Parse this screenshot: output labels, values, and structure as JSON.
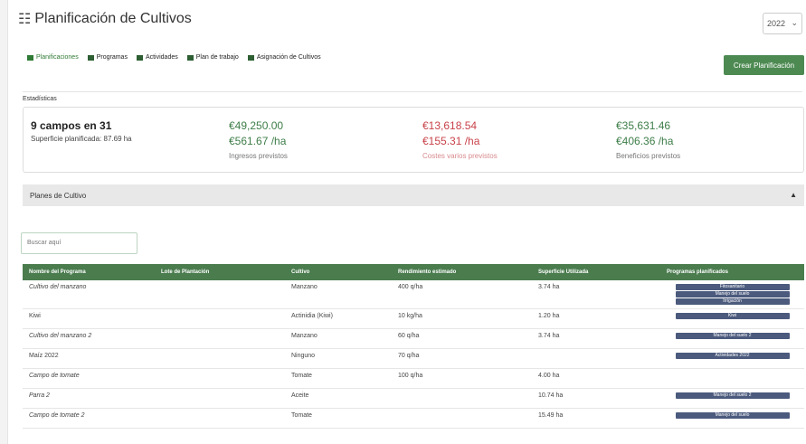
{
  "header": {
    "title": "Planificación de Cultivos",
    "year": "2022"
  },
  "tabs": [
    {
      "label": "Planificaciones",
      "active": true
    },
    {
      "label": "Programas"
    },
    {
      "label": "Actividades"
    },
    {
      "label": "Plan de trabajo"
    },
    {
      "label": "Asignación de Cultivos"
    }
  ],
  "create_button": "Crear Planificación",
  "stats": {
    "label": "Estadísticas",
    "campos": "9 campos en 31",
    "superficie": "Superficie planificada: 87.69 ha",
    "ingresos_total": "€49,250.00",
    "ingresos_ha": "€561.67 /ha",
    "ingresos_label": "Ingresos previstos",
    "costes_total": "€13,618.54",
    "costes_ha": "€155.31 /ha",
    "costes_label": "Costes varios previstos",
    "beneficios_total": "€35,631.46",
    "beneficios_ha": "€406.36 /ha",
    "beneficios_label": "Beneficios previstos"
  },
  "plans": {
    "title": "Planes de Cultivo",
    "search_placeholder": "Buscar aquí"
  },
  "table": {
    "headers": [
      "Nombre del Programa",
      "Lote de Plantación",
      "Cultivo",
      "Rendimiento estimado",
      "Superficie Utilizada",
      "Programas planificados"
    ],
    "rows": [
      {
        "name": "Cultivo del manzano",
        "lote": "",
        "cultivo": "Manzano",
        "rend": "400 q/ha",
        "sup": "3.74 ha",
        "programs": [
          "Fitosanitario",
          "Manejo del suelo",
          "Irrigación"
        ]
      },
      {
        "name": "Kiwi",
        "lote": "",
        "cultivo": "Actinidia (Kiwi)",
        "rend": "10 kg/ha",
        "sup": "1.20 ha",
        "programs": [
          "Kiwi"
        ]
      },
      {
        "name": "Cultivo del manzano 2",
        "lote": "",
        "cultivo": "Manzano",
        "rend": "60 q/ha",
        "sup": "3.74 ha",
        "programs": [
          "Manejo del suelo 2"
        ]
      },
      {
        "name": "Maíz 2022",
        "lote": "",
        "cultivo": "Ninguno",
        "rend": "70 q/ha",
        "sup": "",
        "programs": [
          "Actividades 2022"
        ]
      },
      {
        "name": "Campo de tomate",
        "lote": "",
        "cultivo": "Tomate",
        "rend": "100 q/ha",
        "sup": "4.00 ha",
        "programs": []
      },
      {
        "name": "Parra 2",
        "lote": "",
        "cultivo": "Aceite",
        "rend": "",
        "sup": "10.74 ha",
        "programs": [
          "Manejo del suelo 2"
        ]
      },
      {
        "name": "Campo de tomate 2",
        "lote": "",
        "cultivo": "Tomate",
        "rend": "",
        "sup": "15.49 ha",
        "programs": [
          "Manejo del suelo"
        ]
      }
    ]
  }
}
